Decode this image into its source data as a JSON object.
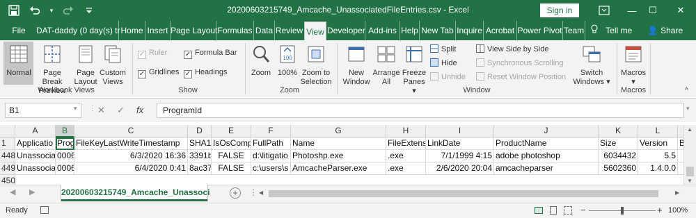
{
  "titlebar": {
    "title": "20200603215749_Amcache_UnassociatedFileEntries.csv  -  Excel",
    "signin": "Sign in",
    "icons": [
      "save-icon",
      "undo-icon",
      "redo-icon",
      "customize-qat-icon",
      "ribbon-display-icon",
      "minimize-icon",
      "maximize-icon",
      "close-icon"
    ],
    "minimize": "—",
    "maximize": "☐",
    "close": "✕",
    "restore": "⧉"
  },
  "menu": {
    "items": [
      "File",
      "DAT-daddy",
      "(0 day(s) tr",
      "Help",
      "Home",
      "Insert",
      "Page Layout",
      "Formulas",
      "Data",
      "Review",
      "View",
      "Developer",
      "Add-ins",
      "Help",
      "New Tab",
      "Inquire",
      "Acrobat",
      "Power Pivot",
      "Team"
    ],
    "dat_daddy": "DAT-daddy  (0 day(s) tr",
    "tell_me": "Tell me",
    "share": "Share",
    "active": "View"
  },
  "ribbon": {
    "workbook_views": {
      "label": "Workbook Views",
      "normal": "Normal",
      "page_break_1": "Page Break",
      "page_break_2": "Preview",
      "page_layout_1": "Page",
      "page_layout_2": "Layout",
      "custom_views_1": "Custom",
      "custom_views_2": "Views"
    },
    "show": {
      "label": "Show",
      "ruler": "Ruler",
      "formula_bar": "Formula Bar",
      "gridlines": "Gridlines",
      "headings": "Headings"
    },
    "zoom": {
      "label": "Zoom",
      "zoom": "Zoom",
      "hundred": "100%",
      "zoom_sel_1": "Zoom to",
      "zoom_sel_2": "Selection"
    },
    "window": {
      "label": "Window",
      "new_window_1": "New",
      "new_window_2": "Window",
      "arrange_1": "Arrange",
      "arrange_2": "All",
      "freeze_1": "Freeze",
      "freeze_2": "Panes ▾",
      "split": "Split",
      "hide": "Hide",
      "unhide": "Unhide",
      "side_by_side": "View Side by Side",
      "sync_scroll": "Synchronous Scrolling",
      "reset_pos": "Reset Window Position",
      "switch_1": "Switch",
      "switch_2": "Windows ▾"
    },
    "macros": {
      "label": "Macros",
      "macros_1": "Macros",
      "macros_2": "▾"
    }
  },
  "formula_bar": {
    "name_box": "B1",
    "cancel": "✕",
    "enter": "✓",
    "fx": "fx",
    "value": "ProgramId"
  },
  "grid": {
    "columns": [
      "A",
      "B",
      "C",
      "D",
      "E",
      "F",
      "G",
      "H",
      "I",
      "J",
      "K",
      "L",
      "M"
    ],
    "selected_column": "B",
    "row_numbers": [
      "1",
      "448",
      "449",
      "450"
    ],
    "headers": [
      "Applicatio",
      "ProgramId",
      "FileKeyLastWriteTimestamp",
      "SHA1",
      "IsOsComp",
      "FullPath",
      "Name",
      "FileExtens",
      "LinkDate",
      "ProductName",
      "Size",
      "Version",
      "B"
    ],
    "rows": [
      [
        "Unassocia",
        "0006",
        "6/3/2020 16:36",
        "3391b",
        "FALSE",
        "d:\\litigatio",
        "Photoshp.exe",
        ".exe",
        "7/1/1999 4:15",
        "adobe photoshop",
        "6034432",
        "5.5",
        ""
      ],
      [
        "Unassocia",
        "0006",
        "6/4/2020 0:41",
        "8ac37",
        "FALSE",
        "c:\\users\\s",
        "AmcacheParser.exe",
        ".exe",
        "2/6/2020 20:04",
        "amcacheparser",
        "5602360",
        "1.4.0.0",
        ""
      ]
    ]
  },
  "sheet": {
    "tab": "20200603215749_Amcache_Unassoci",
    "add": "+",
    "prev": "◀",
    "next": "▶"
  },
  "status": {
    "ready": "Ready",
    "zoom": "100%",
    "minus": "−",
    "plus": "+"
  },
  "colors": {
    "accent": "#217346",
    "ribbon": "#f3f3f3"
  }
}
